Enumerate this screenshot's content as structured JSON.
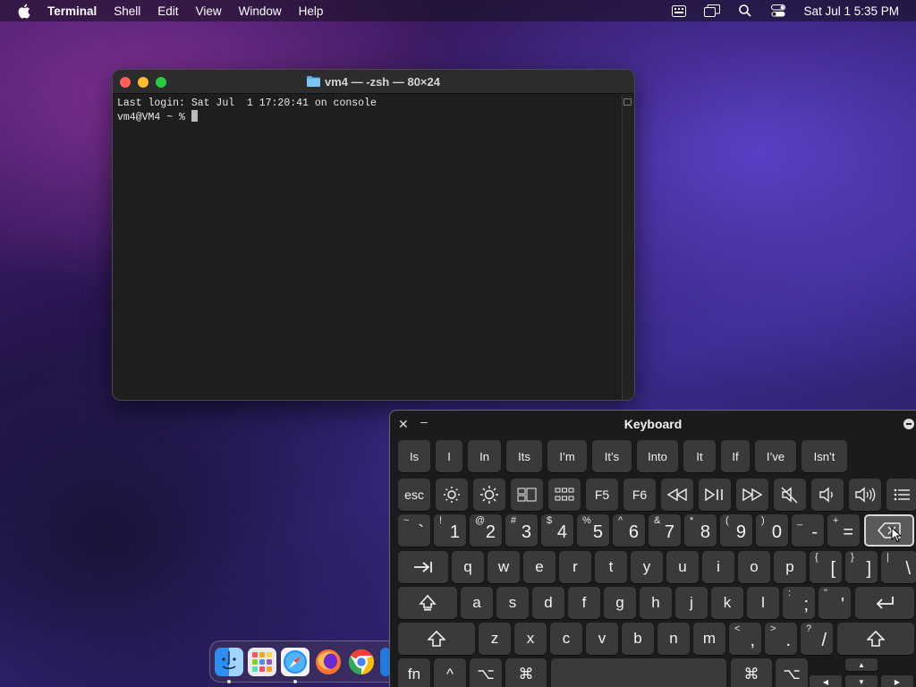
{
  "menubar": {
    "app_name": "Terminal",
    "menus": [
      "Shell",
      "Edit",
      "View",
      "Window",
      "Help"
    ],
    "status_icons": [
      "keyboard-input-icon",
      "screen-mirroring-icon",
      "spotlight-search-icon",
      "control-center-icon"
    ],
    "clock": "Sat Jul 1  5:35 PM"
  },
  "terminal": {
    "title": "vm4 — -zsh — 80×24",
    "lines": [
      "Last login: Sat Jul  1 17:20:41 on console",
      "vm4@VM4 ~ % "
    ]
  },
  "dock": {
    "apps": [
      {
        "name": "Finder",
        "icon": "finder-icon",
        "running": true
      },
      {
        "name": "Launchpad",
        "icon": "launchpad-icon",
        "running": false
      },
      {
        "name": "Safari",
        "icon": "safari-icon",
        "running": true
      },
      {
        "name": "Firefox",
        "icon": "firefox-icon",
        "running": false
      },
      {
        "name": "Chrome",
        "icon": "chrome-icon",
        "running": false
      },
      {
        "name": "Partial",
        "icon": "app-icon",
        "running": false
      }
    ]
  },
  "keyboard": {
    "title": "Keyboard",
    "predictions": [
      "Is",
      "I",
      "In",
      "Its",
      "I’m",
      "It’s",
      "Into",
      "It",
      "If",
      "I’ve",
      "Isn’t"
    ],
    "function_row": {
      "esc": "esc",
      "f5": "F5",
      "f6": "F6",
      "icons": [
        "brightness-down-icon",
        "brightness-up-icon",
        "mission-control-icon",
        "launchpad-grid-icon",
        "rewind-icon",
        "play-pause-icon",
        "fast-forward-icon",
        "mute-icon",
        "volume-down-icon",
        "volume-up-icon",
        "list-icon"
      ]
    },
    "number_row": [
      {
        "sup": "~",
        "main": "`"
      },
      {
        "sup": "!",
        "main": "1"
      },
      {
        "sup": "@",
        "main": "2"
      },
      {
        "sup": "#",
        "main": "3"
      },
      {
        "sup": "$",
        "main": "4"
      },
      {
        "sup": "%",
        "main": "5"
      },
      {
        "sup": "^",
        "main": "6"
      },
      {
        "sup": "&",
        "main": "7"
      },
      {
        "sup": "*",
        "main": "8"
      },
      {
        "sup": "(",
        "main": "9"
      },
      {
        "sup": ")",
        "main": "0"
      },
      {
        "sup": "_",
        "main": "-"
      },
      {
        "sup": "+",
        "main": "="
      }
    ],
    "qwerty_row": [
      "q",
      "w",
      "e",
      "r",
      "t",
      "y",
      "u",
      "i",
      "o",
      "p"
    ],
    "qwerty_extra": [
      {
        "sup": "{",
        "main": "["
      },
      {
        "sup": "}",
        "main": "]"
      },
      {
        "sup": "|",
        "main": "\\"
      }
    ],
    "home_row": [
      "a",
      "s",
      "d",
      "f",
      "g",
      "h",
      "j",
      "k",
      "l"
    ],
    "home_extra": [
      {
        "sup": ":",
        "main": ";"
      },
      {
        "sup": "\"",
        "main": "'"
      }
    ],
    "bottom_row": [
      "z",
      "x",
      "c",
      "v",
      "b",
      "n",
      "m"
    ],
    "bottom_extra": [
      {
        "sup": "<",
        "main": ","
      },
      {
        "sup": ">",
        "main": "."
      },
      {
        "sup": "?",
        "main": "/"
      }
    ],
    "modifiers": {
      "fn": "fn",
      "control": "^",
      "option": "⌥",
      "command": "⌘"
    },
    "arrows": {
      "up": "▲",
      "left": "◀",
      "down": "▼",
      "right": "▶"
    }
  }
}
